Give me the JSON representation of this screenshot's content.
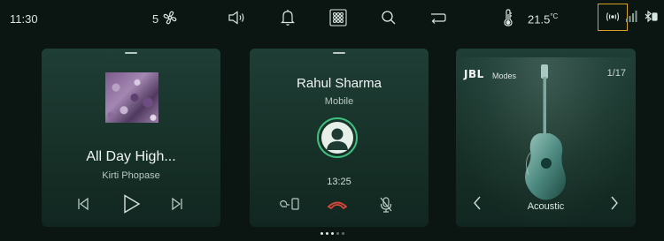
{
  "status_bar": {
    "time": "11:30",
    "fan_speed": "5",
    "temperature": "21.5",
    "temperature_unit": "°C",
    "icons": [
      "fan-icon",
      "volume-icon",
      "bell-icon",
      "apps-grid-icon",
      "search-icon",
      "back-icon",
      "thermometer-icon",
      "wireless-icon",
      "signal-icon",
      "bluetooth-icon"
    ],
    "highlight_color": "#d8a324"
  },
  "media": {
    "title": "All Day High...",
    "artist": "Kirti Phopase",
    "controls": [
      "previous-icon",
      "play-icon",
      "next-icon"
    ]
  },
  "call": {
    "name": "Rahul Sharma",
    "type": "Mobile",
    "duration": "13:25",
    "controls": [
      "transfer-to-phone-icon",
      "end-call-icon",
      "mute-mic-icon"
    ],
    "accent": "#3fc07f",
    "end_call_color": "#d6463c"
  },
  "audio": {
    "brand": "JBL",
    "label": "Modes",
    "counter": "1/17",
    "mode": "Acoustic"
  },
  "pager": {
    "pages": 5,
    "active": 1
  }
}
